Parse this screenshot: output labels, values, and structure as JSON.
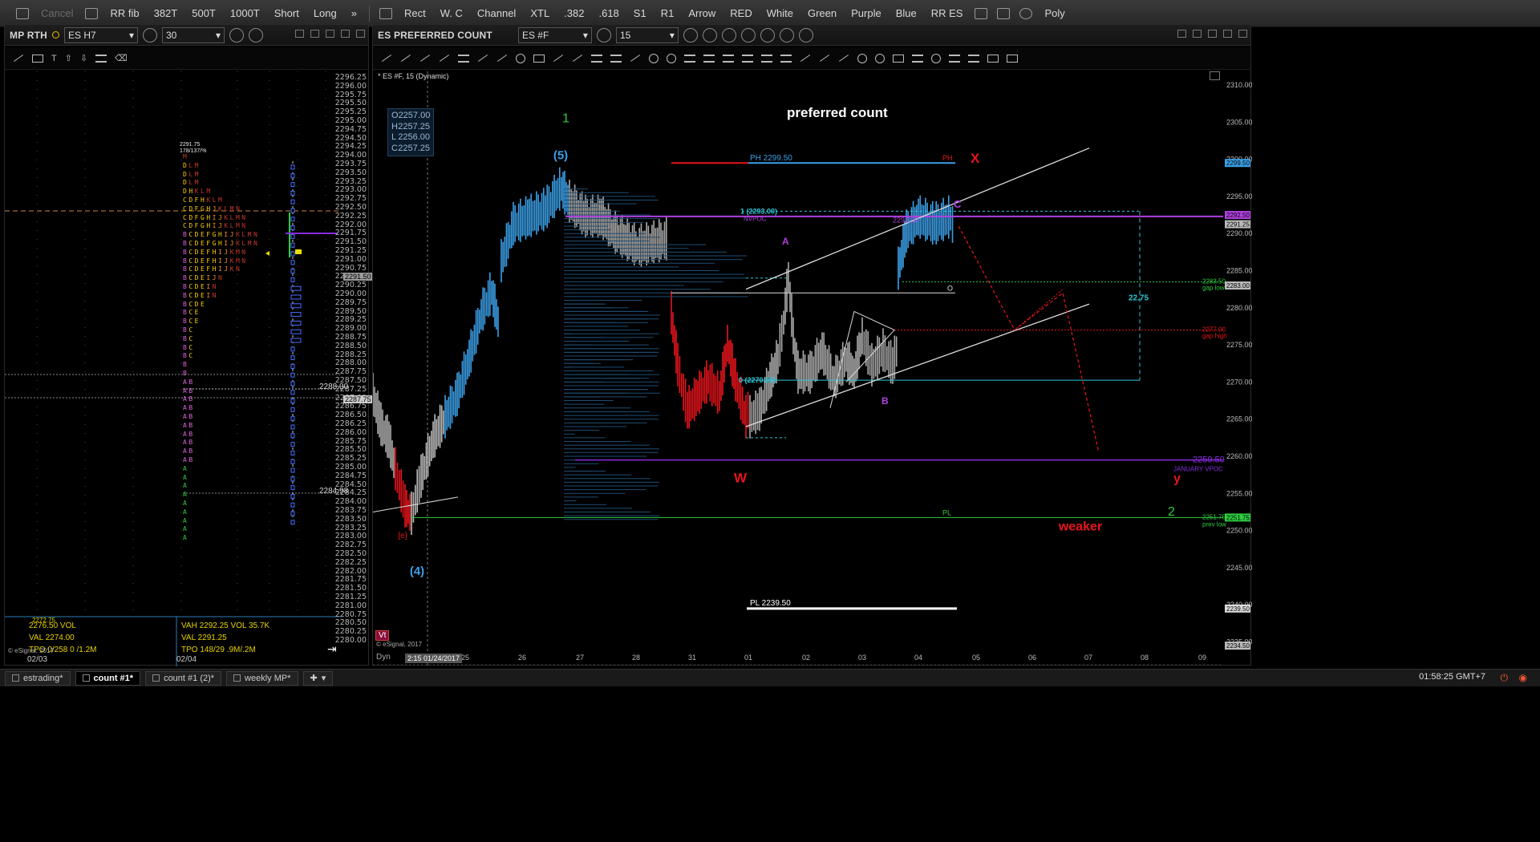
{
  "toolbar": {
    "cancel": "Cancel",
    "items": [
      "RR fib",
      "382T",
      "500T",
      "1000T",
      "Short",
      "Long"
    ],
    "more": "»",
    "draw_items": [
      "Rect",
      "W. C",
      "Channel",
      "XTL",
      ".382",
      ".618",
      "S1",
      "R1",
      "Arrow",
      "RED",
      "White",
      "Green",
      "Purple",
      "Blue",
      "RR ES"
    ],
    "poly": "Poly"
  },
  "left_panel": {
    "name": "MP RTH",
    "symbol": "ES H7",
    "interval": "30",
    "prices": [
      "2296.25",
      "2296.00",
      "2295.75",
      "2295.50",
      "2295.25",
      "2295.00",
      "2294.75",
      "2294.50",
      "2294.25",
      "2294.00",
      "2293.75",
      "2293.50",
      "2293.25",
      "2293.00",
      "2292.75",
      "2292.50",
      "2292.25",
      "2292.00",
      "2291.75",
      "2291.50",
      "2291.25",
      "2291.00",
      "2290.75",
      "2290.50",
      "2290.25",
      "2290.00",
      "2289.75",
      "2289.50",
      "2289.25",
      "2289.00",
      "2288.75",
      "2288.50",
      "2288.25",
      "2288.00",
      "2287.75",
      "2287.50",
      "2287.25",
      "2287.00",
      "2286.75",
      "2286.50",
      "2286.25",
      "2286.00",
      "2285.75",
      "2285.50",
      "2285.25",
      "2285.00",
      "2284.75",
      "2284.50",
      "2284.25",
      "2284.00",
      "2283.75",
      "2283.50",
      "2283.25",
      "2283.00",
      "2282.75",
      "2282.50",
      "2282.25",
      "2282.00",
      "2281.75",
      "2281.50",
      "2281.25",
      "2281.00",
      "2280.75",
      "2280.50",
      "2280.25",
      "2280.00"
    ],
    "tpo_rows": [
      {
        "t": "M",
        "c": "#c0392b"
      },
      {
        "t": "DLM",
        "c": "#e8c000"
      },
      {
        "t": "DLM",
        "c": "#e8c000"
      },
      {
        "t": "DLM",
        "c": "#e8c000"
      },
      {
        "t": "DHKLM",
        "c": "#e8c000"
      },
      {
        "t": "CDFHKLM",
        "c": "#e8c000"
      },
      {
        "t": "CDFGHJKLMN",
        "c": "#e8c000"
      },
      {
        "t": "CDFGHIJKLMN",
        "c": "#e8c000"
      },
      {
        "t": "CDFGHIJKLMN",
        "c": "#e8c000"
      },
      {
        "t": "BCDEFGHIJKLMN",
        "c": "#e8c000"
      },
      {
        "t": "BCDEFGHIJKLMN",
        "c": "#e8c000"
      },
      {
        "t": "BCDEFHIJKMN",
        "c": "#e8c000"
      },
      {
        "t": "BCDEFHIJKMN",
        "c": "#e8c000"
      },
      {
        "t": "BCDEFHIJKN",
        "c": "#e8c000"
      },
      {
        "t": "BCDEIJN",
        "c": "#e8c000"
      },
      {
        "t": "BCDEIN",
        "c": "#e8c000"
      },
      {
        "t": "BCDEIN",
        "c": "#e8c000"
      },
      {
        "t": "BCDE",
        "c": "#e8c000"
      },
      {
        "t": "BCE",
        "c": "#e8c000"
      },
      {
        "t": "BCE",
        "c": "#e8c000"
      },
      {
        "t": "BC",
        "c": "#e8c000"
      },
      {
        "t": "BC",
        "c": "#e8c000"
      },
      {
        "t": "BC",
        "c": "#e8c000"
      },
      {
        "t": "BC",
        "c": "#e8c000"
      },
      {
        "t": "B",
        "c": "#e060e0"
      },
      {
        "t": "B",
        "c": "#e060e0"
      },
      {
        "t": "AB",
        "c": "#e060e0"
      },
      {
        "t": "AB",
        "c": "#e060e0"
      },
      {
        "t": "AB",
        "c": "#e060e0"
      },
      {
        "t": "AB",
        "c": "#e060e0"
      },
      {
        "t": "AB",
        "c": "#e060e0"
      },
      {
        "t": "AB",
        "c": "#e060e0"
      },
      {
        "t": "AB",
        "c": "#e060e0"
      },
      {
        "t": "AB",
        "c": "#e060e0"
      },
      {
        "t": "AB",
        "c": "#e060e0"
      },
      {
        "t": "AB",
        "c": "#e060e0"
      },
      {
        "t": "A",
        "c": "#2ecc40"
      },
      {
        "t": "A",
        "c": "#2ecc40"
      },
      {
        "t": "A",
        "c": "#2ecc40"
      },
      {
        "t": "A",
        "c": "#2ecc40"
      },
      {
        "t": "A",
        "c": "#2ecc40"
      },
      {
        "t": "A",
        "c": "#2ecc40"
      },
      {
        "t": "A",
        "c": "#2ecc40"
      },
      {
        "t": "A",
        "c": "#2ecc40"
      },
      {
        "t": "A",
        "c": "#2ecc40"
      }
    ],
    "poc_label": "2291.75\n178/137/%",
    "level_2288": "2288.00",
    "level_2284": "2284.98",
    "tag_2287": "2287.75",
    "tag_2291": "2291.50",
    "stats_left": [
      "2276.50  VOL",
      "VAL 2274.00",
      "TPO 0/258   0 /1.2M"
    ],
    "stats_right": [
      "VAH 2292.25   VOL 35.7K",
      "VAL 2291.25",
      "TPO 148/29   .9M/.2M"
    ],
    "stat_top_left": "2272.75",
    "dates": [
      "02/03",
      "02/04"
    ],
    "esignal": "© eSignal, 2017"
  },
  "main_panel": {
    "name": "ES PREFERRED COUNT",
    "symbol": "ES #F",
    "interval": "15",
    "subtitle": "* ES #F, 15 (Dynamic)",
    "ohlc": {
      "O": "2257.00",
      "H": "2257.25",
      "L": "2256.00",
      "C": "2257.25"
    },
    "title": "preferred count",
    "labels": {
      "wave1": "1",
      "wave5": "(5)",
      "wave4": "(4)",
      "wave_e": "[e]",
      "X": "X",
      "C": "C",
      "A": "A",
      "B": "B",
      "W": "W",
      "y": "y",
      "two": "2",
      "weaker": "weaker"
    },
    "annotations": {
      "ph": "PH 2299.50",
      "ph_small": "PH",
      "fib1": "1 (2293.00)",
      "nvpoc": "NVPOC",
      "fib0": "0 (2270.25)",
      "pl_small": "PL",
      "pl": "PL 2239.50",
      "range": "22.75",
      "gap_low_val": "2283.50",
      "gap_low": "gap low",
      "gap_high_val": "2277.00",
      "gap_high": "gap high",
      "jan_vpoc_val": "2259.50",
      "jan_vpoc": "JANUARY VPOC",
      "prev_low_val": "2251.75",
      "prev_low": "prev low",
      "peak_label": "2292.50",
      "o_label": "O"
    },
    "price_axis": [
      "2315.00",
      "2310.00",
      "2305.00",
      "2300.00",
      "2295.00",
      "2290.00",
      "2285.00",
      "2280.00",
      "2275.00",
      "2270.00",
      "2265.00",
      "2260.00",
      "2255.00",
      "2250.00",
      "2245.00",
      "2240.00",
      "2235.00"
    ],
    "tags": {
      "t2299": "2299.50",
      "t2291": "2291.25",
      "t2292": "2292.50",
      "t2283": "2283.00",
      "t2251": "2251.75",
      "t2239": "2239.50",
      "t2234": "2234.50"
    },
    "dates": [
      "25",
      "26",
      "27",
      "28",
      "31",
      "01",
      "02",
      "03",
      "04",
      "05",
      "06",
      "07",
      "08",
      "09"
    ],
    "cursor_time": "2:15 01/24/2017",
    "dyn": "Dyn",
    "esignal": "© eSignal, 2017",
    "vt": "Vt"
  },
  "tabs": [
    {
      "label": "estrading*",
      "active": false
    },
    {
      "label": "count #1*",
      "active": true
    },
    {
      "label": "count #1 (2)*",
      "active": false
    },
    {
      "label": "weekly MP*",
      "active": false
    }
  ],
  "clock": "01:58:25 GMT+7",
  "colors": {
    "red": "#e8141c",
    "blue": "#3ba0e8",
    "green": "#2ecc40",
    "purple": "#b040e0",
    "cyan": "#31c8d8"
  }
}
